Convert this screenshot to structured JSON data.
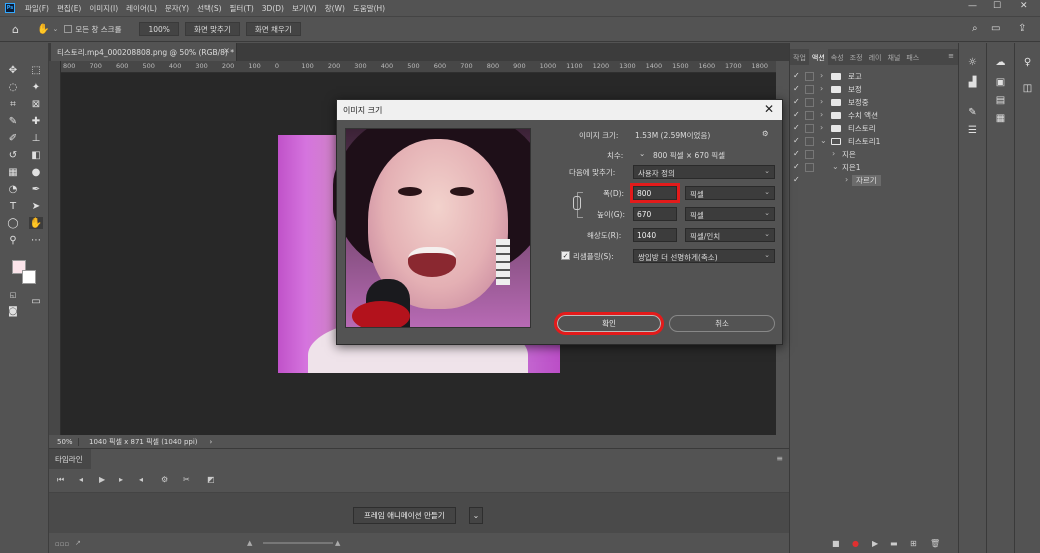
{
  "menubar": {
    "logo": "Ps",
    "items": [
      "파일(F)",
      "편집(E)",
      "이미지(I)",
      "레이어(L)",
      "문자(Y)",
      "선택(S)",
      "필터(T)",
      "3D(D)",
      "보기(V)",
      "창(W)",
      "도움말(H)"
    ],
    "minimize": "—",
    "maximize": "☐",
    "close": "✕"
  },
  "options": {
    "scroll_all_label": "모든 창 스크롤",
    "zoom_value": "100%",
    "fit_screen": "화면 맞추기",
    "fill_screen": "화면 채우기"
  },
  "document": {
    "tab_title": "티스토리.mp4_000208808.png @ 50% (RGB/8) *",
    "tab_close": "×",
    "ruler_ticks": [
      "800",
      "700",
      "600",
      "500",
      "400",
      "300",
      "200",
      "100",
      "0",
      "100",
      "200",
      "300",
      "400",
      "500",
      "600",
      "700",
      "800",
      "900",
      "1000",
      "1100",
      "1200",
      "1300",
      "1400",
      "1500",
      "1600",
      "1700",
      "1800"
    ]
  },
  "statusbar": {
    "zoom": "50%",
    "info": "1040 픽셀 x 871 픽셀 (1040 ppi)",
    "arrow": "›"
  },
  "timeline": {
    "tab_label": "타임라인",
    "create_button": "프레임 애니메이션 만들기",
    "menu": "≡"
  },
  "panel": {
    "tabs": [
      "작업",
      "액션",
      "속성",
      "조정",
      "레이",
      "채널",
      "패스"
    ],
    "active_tab": "액션",
    "menu": "≡",
    "actions": [
      {
        "label": "로고",
        "type": "folder",
        "indent": 0
      },
      {
        "label": "보정",
        "type": "folder",
        "indent": 0
      },
      {
        "label": "보정중",
        "type": "folder",
        "indent": 0
      },
      {
        "label": "수치 액션",
        "type": "folder",
        "indent": 0
      },
      {
        "label": "티스토리",
        "type": "folder",
        "indent": 0
      },
      {
        "label": "티스토리1",
        "type": "folder-open",
        "indent": 0
      },
      {
        "label": "지은",
        "type": "action",
        "indent": 1
      },
      {
        "label": "지은1",
        "type": "action-open",
        "indent": 1
      },
      {
        "label": "자르기",
        "type": "step",
        "indent": 2
      }
    ]
  },
  "dialog": {
    "title": "이미지 크기",
    "close": "✕",
    "image_size_label": "이미지 크기:",
    "image_size_value": "1.53M (2.59M이었음)",
    "dimensions_label": "치수:",
    "dimensions_value": "800 픽셀 × 670 픽셀",
    "fit_to_label": "다음에 맞추기:",
    "fit_to_value": "사용자 정의",
    "width_label": "폭(D):",
    "width_value": "800",
    "width_unit": "픽셀",
    "height_label": "높이(G):",
    "height_value": "670",
    "height_unit": "픽셀",
    "resolution_label": "해상도(R):",
    "resolution_value": "1040",
    "resolution_unit": "픽셀/인치",
    "resample_label": "리샘플링(S):",
    "resample_value": "쌍입방 더 선명하게(축소)",
    "resample_checked": "✓",
    "ok_label": "확인",
    "cancel_label": "취소"
  },
  "colors": {
    "accent_highlight": "#e31b1b",
    "ps_blue": "#31a8ff",
    "foreground_swatch": "#fbe4ea",
    "background_swatch": "#ffffff"
  }
}
